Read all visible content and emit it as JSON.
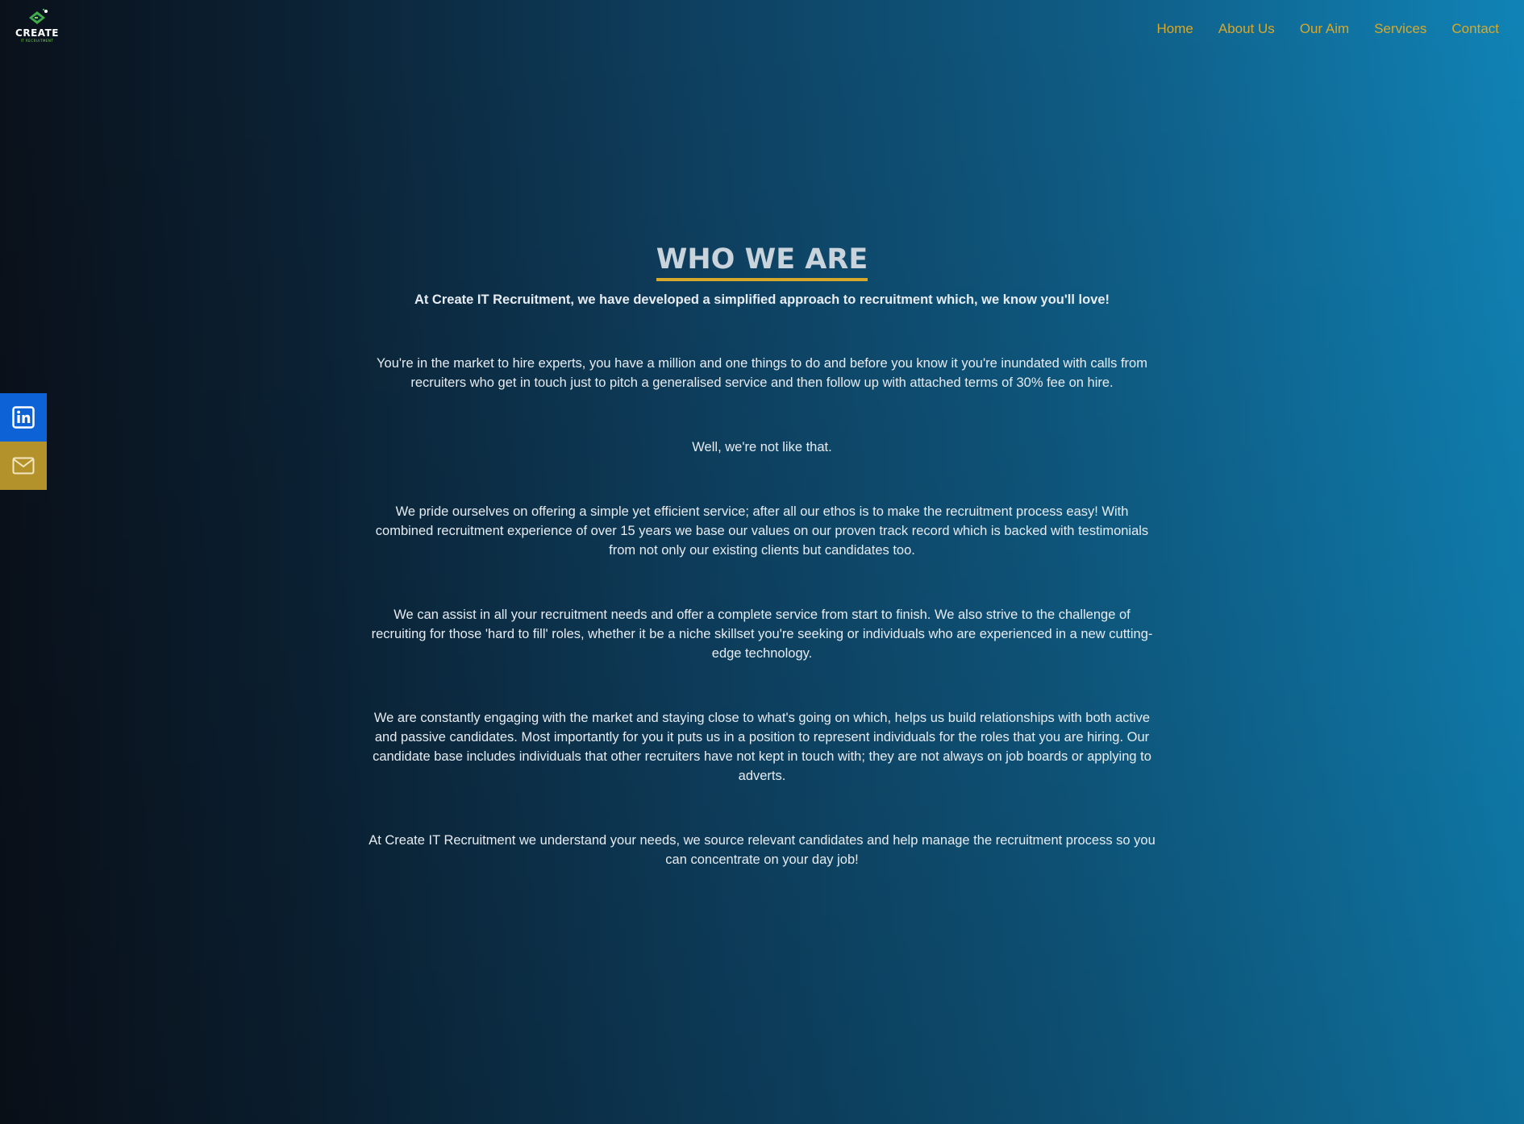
{
  "brand": {
    "logo_text": "CREATE",
    "logo_sub": "IT RECRUITMENT",
    "accent_color": "#d6a92c",
    "logo_green": "#3fae49"
  },
  "nav": {
    "items": [
      {
        "label": "Home"
      },
      {
        "label": "About Us"
      },
      {
        "label": "Our Aim"
      },
      {
        "label": "Services"
      },
      {
        "label": "Contact"
      }
    ]
  },
  "social": {
    "linkedin_icon": "linkedin-icon",
    "mail_icon": "mail-icon",
    "linkedin_color": "#0d63d6",
    "mail_color": "#b3922c"
  },
  "content": {
    "heading": "WHO WE ARE",
    "subtitle": "At Create IT Recruitment, we have developed a simplified approach to recruitment which, we know you'll love!",
    "paragraphs": [
      "You're in the market to hire experts, you have a million and one things to do and before you know it you're inundated with calls from recruiters who get in touch just to pitch a generalised service and then follow up with attached terms of 30% fee on hire.",
      "Well, we're not like that.",
      "We pride ourselves on offering a simple yet efficient service; after all our ethos is to make the recruitment process easy! With combined recruitment experience of over 15 years we base our values on our proven track record which is backed with testimonials from not only our existing clients but candidates too.",
      "We can assist in all your recruitment needs and offer a complete service from start to finish. We also strive to the challenge of recruiting for those 'hard to fill' roles, whether it be a niche skillset you're seeking or individuals who are experienced in a new cutting-edge technology.",
      "We are constantly engaging with the market and staying close to what's going on which, helps us build relationships with both active and passive candidates. Most importantly for you it puts us in a position to represent individuals for the roles that you are hiring. Our candidate base includes individuals that other recruiters have not kept in touch with; they are not always on job boards or applying to adverts.",
      "At Create IT Recruitment we understand your needs, we source relevant candidates and help manage the recruitment process so you can concentrate on your day job!"
    ]
  }
}
